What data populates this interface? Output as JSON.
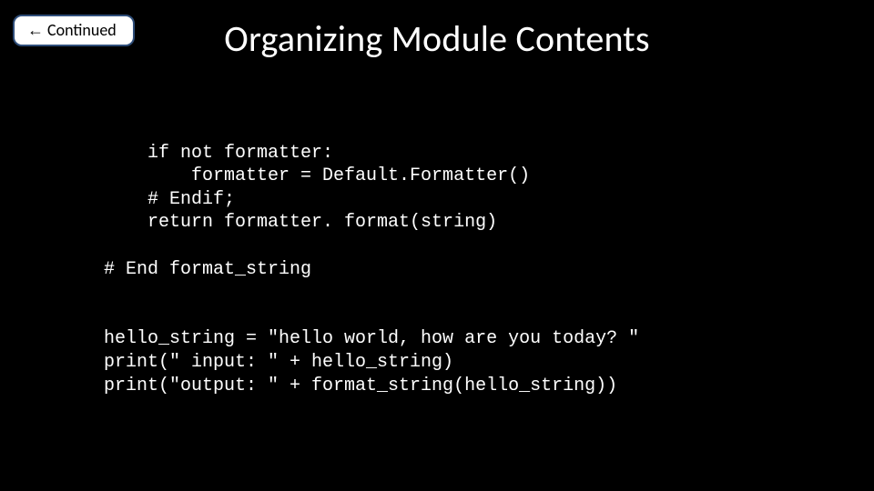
{
  "badge": {
    "arrow": "←",
    "label": "Continued"
  },
  "title": "Organizing Module Contents",
  "code": {
    "l1": "    if not formatter:",
    "l2": "        formatter = Default.Formatter()",
    "l3": "    # Endif;",
    "l4": "    return formatter. format(string)",
    "l5": "",
    "l6": "# End format_string",
    "l7": "",
    "l8": "",
    "l9": "hello_string = \"hello world, how are you today? \"",
    "l10": "print(\" input: \" + hello_string)",
    "l11": "print(\"output: \" + format_string(hello_string))"
  }
}
